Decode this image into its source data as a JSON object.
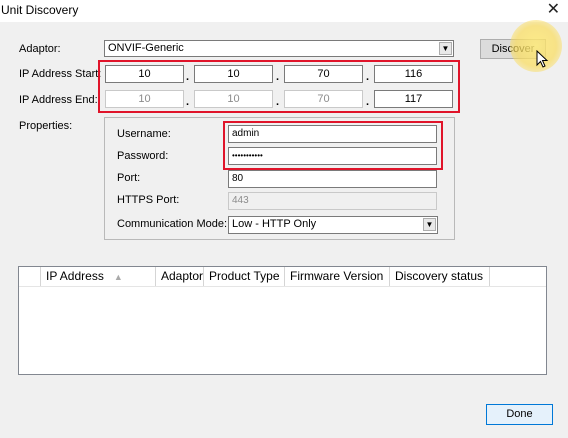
{
  "window": {
    "title": "Unit Discovery",
    "close_glyph": "✕"
  },
  "adaptor": {
    "label": "Adaptor:",
    "value": "ONVIF-Generic"
  },
  "discover_button": "Discover",
  "ip_start": {
    "label": "IP Address Start:",
    "octets": [
      "10",
      "10",
      "70",
      "116"
    ]
  },
  "ip_end": {
    "label": "IP Address End:",
    "octets": [
      "10",
      "10",
      "70",
      "117"
    ]
  },
  "properties": {
    "label": "Properties:",
    "username": {
      "label": "Username:",
      "value": "admin"
    },
    "password": {
      "label": "Password:",
      "value": "•••••••••••"
    },
    "port": {
      "label": "Port:",
      "value": "80"
    },
    "https_port": {
      "label": "HTTPS Port:",
      "value": "443"
    },
    "comm_mode": {
      "label": "Communication Mode:",
      "value": "Low - HTTP Only"
    }
  },
  "results_table": {
    "columns": [
      "IP Address",
      "Adaptor",
      "Product Type",
      "Firmware Version",
      "Discovery status"
    ],
    "sort_indicator": "▲"
  },
  "done_button": "Done",
  "colors": {
    "highlight": "#e0142a",
    "primary_border": "#0078d7"
  },
  "icons": {
    "dropdown": "chevron-down-icon",
    "close": "close-icon"
  }
}
